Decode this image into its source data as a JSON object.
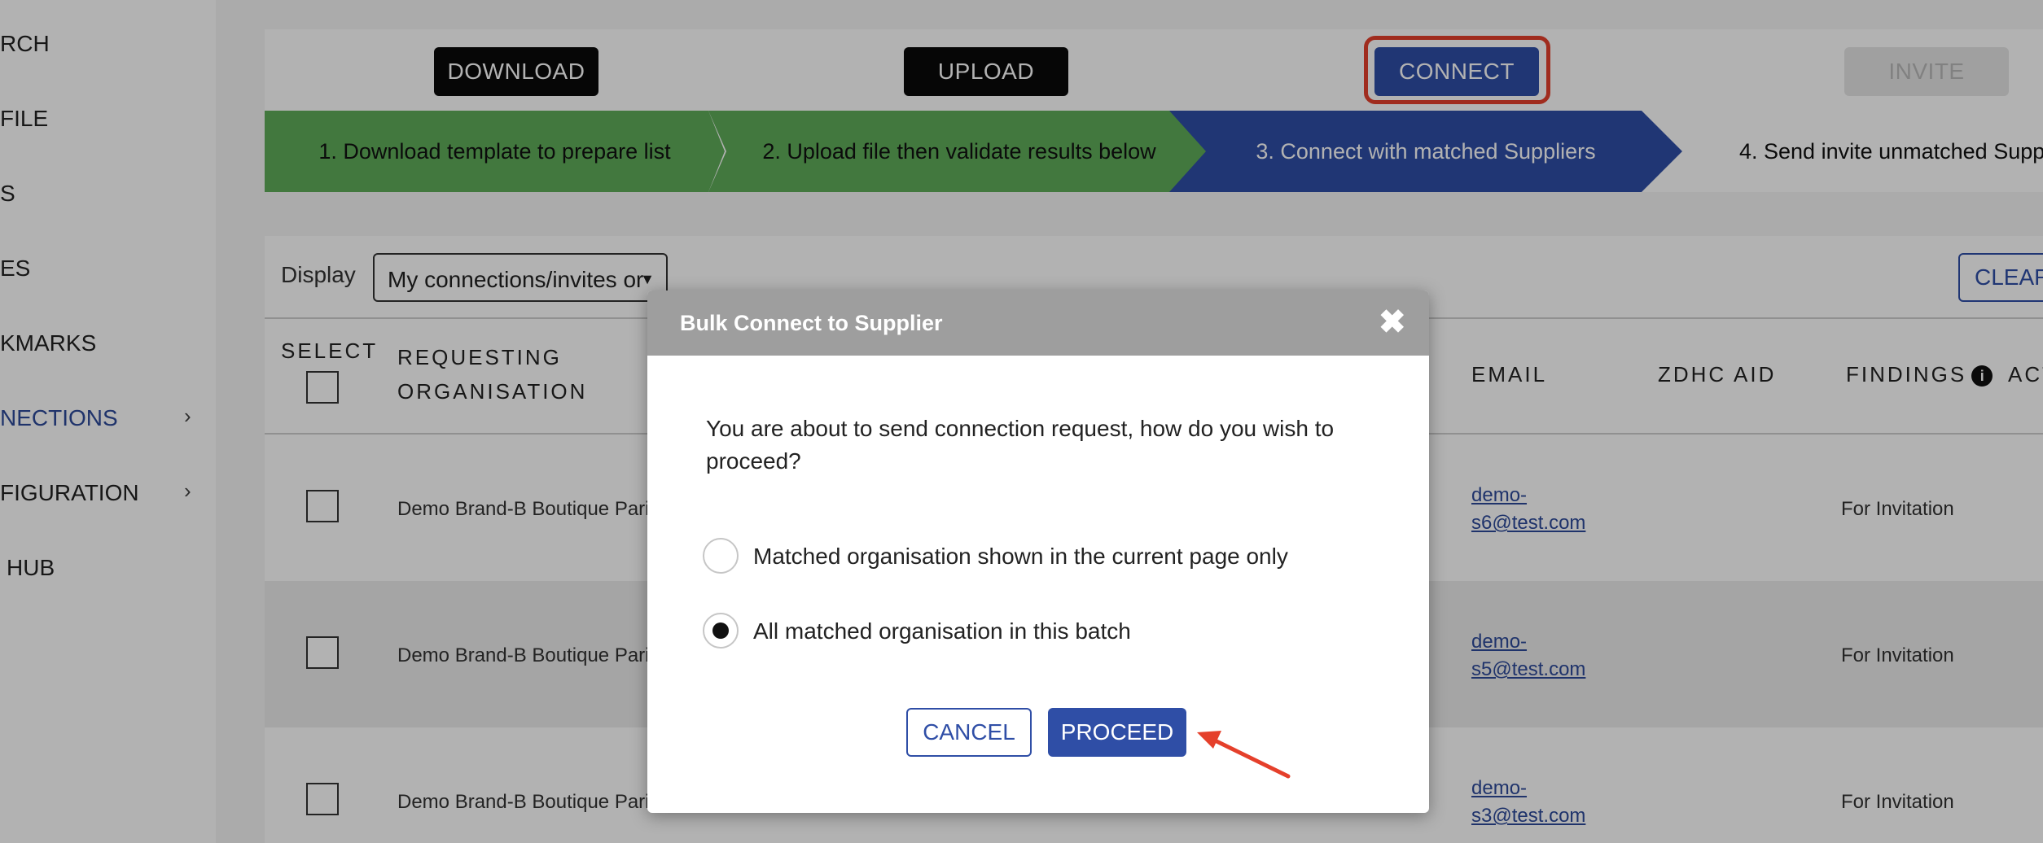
{
  "sidebar": {
    "items": [
      {
        "label": "RCH",
        "chevron": false,
        "active": false
      },
      {
        "label": "FILE",
        "chevron": false,
        "active": false
      },
      {
        "label": "S",
        "chevron": false,
        "active": false
      },
      {
        "label": "ES",
        "chevron": false,
        "active": false
      },
      {
        "label": "KMARKS",
        "chevron": false,
        "active": false
      },
      {
        "label": "NECTIONS",
        "chevron": true,
        "active": true
      },
      {
        "label": "FIGURATION",
        "chevron": true,
        "active": false
      },
      {
        "label": "HUB",
        "chevron": false,
        "active": false
      }
    ],
    "chevron_glyph": "›"
  },
  "actions": {
    "download": "DOWNLOAD",
    "upload": "UPLOAD",
    "connect": "CONNECT",
    "invite": "INVITE"
  },
  "steps": [
    "1. Download template to prepare list",
    "2. Upload file then validate results below",
    "3. Connect with matched Suppliers",
    "4. Send invite unmatched Supp"
  ],
  "filter": {
    "display_label": "Display",
    "display_value": "My connections/invites or",
    "clear_label": "CLEAR"
  },
  "table": {
    "headers": {
      "select": "SELECT",
      "requesting_org_line1": "REQUESTING",
      "requesting_org_line2": "ORGANISATION",
      "email": "EMAIL",
      "zdhc_aid": "ZDHC AID",
      "findings": "FINDINGS",
      "actions": "ACT"
    },
    "rows": [
      {
        "org": "Demo Brand-B Boutique Pari",
        "email_line1": "demo-",
        "email_line2": "s6@test.com",
        "finding": "For Invitation"
      },
      {
        "org": "Demo Brand-B Boutique Pari",
        "email_line1": "demo-",
        "email_line2": "s5@test.com",
        "finding": "For Invitation"
      },
      {
        "org": "Demo Brand-B Boutique Pari",
        "email_line1": "demo-",
        "email_line2": "s3@test.com",
        "finding": "For Invitation"
      }
    ]
  },
  "modal": {
    "title": "Bulk Connect to Supplier",
    "close_glyph": "✖",
    "message": "You are about to send connection request, how do you wish to proceed?",
    "options": [
      {
        "label": "Matched organisation shown in the current page only",
        "selected": false
      },
      {
        "label": "All matched organisation in this batch",
        "selected": true
      }
    ],
    "cancel": "CANCEL",
    "proceed": "PROCEED"
  },
  "colors": {
    "brand_blue": "#2f4ea6",
    "step_green": "#5fac5a",
    "highlight_red": "#e5402b"
  }
}
